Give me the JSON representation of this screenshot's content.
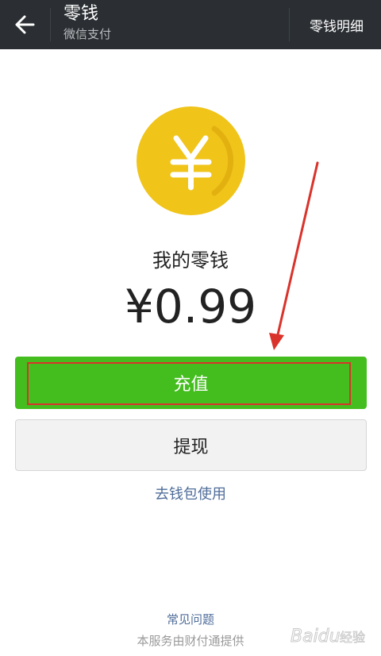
{
  "header": {
    "title": "零钱",
    "subtitle": "微信支付",
    "detail_link": "零钱明细"
  },
  "balance": {
    "label": "我的零钱",
    "amount": "¥0.99"
  },
  "actions": {
    "recharge_label": "充值",
    "withdraw_label": "提现"
  },
  "links": {
    "wallet": "去钱包使用",
    "faq": "常见问题",
    "provider": "本服务由财付通提供"
  },
  "icons": {
    "back": "back-arrow-icon",
    "coin": "yuan-coin-icon"
  },
  "colors": {
    "header_bg": "#2b2f33",
    "primary_green": "#44bd1f",
    "coin_yellow": "#f0c419",
    "annotation_red": "#d9332b",
    "link_blue": "#4f6d9a"
  },
  "watermark": {
    "text": "Baidu经验"
  }
}
